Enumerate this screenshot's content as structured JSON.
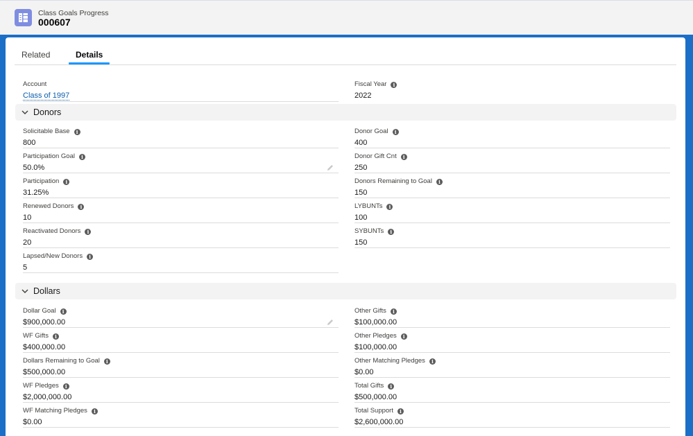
{
  "header": {
    "object_type": "Class Goals Progress",
    "record_name": "000607"
  },
  "tabs": [
    {
      "label": "Related"
    },
    {
      "label": "Details"
    }
  ],
  "top_fields": {
    "account": {
      "label": "Account",
      "value": "Class of 1997"
    },
    "fiscal_year": {
      "label": "Fiscal Year",
      "value": "2022"
    }
  },
  "donors": {
    "title": "Donors",
    "left": [
      {
        "label": "Solicitable Base",
        "value": "800"
      },
      {
        "label": "Participation Goal",
        "value": "50.0%"
      },
      {
        "label": "Participation",
        "value": "31.25%"
      },
      {
        "label": "Renewed Donors",
        "value": "10"
      },
      {
        "label": "Reactivated Donors",
        "value": "20"
      },
      {
        "label": "Lapsed/New Donors",
        "value": "5"
      }
    ],
    "right": [
      {
        "label": "Donor Goal",
        "value": "400"
      },
      {
        "label": "Donor Gift Cnt",
        "value": "250"
      },
      {
        "label": "Donors Remaining to Goal",
        "value": "150"
      },
      {
        "label": "LYBUNTs",
        "value": "100"
      },
      {
        "label": "SYBUNTs",
        "value": "150"
      }
    ]
  },
  "dollars": {
    "title": "Dollars",
    "left": [
      {
        "label": "Dollar Goal",
        "value": "$900,000.00"
      },
      {
        "label": "WF Gifts",
        "value": "$400,000.00"
      },
      {
        "label": "Dollars Remaining to Goal",
        "value": "$500,000.00"
      },
      {
        "label": "WF Pledges",
        "value": "$2,000,000.00"
      },
      {
        "label": "WF Matching Pledges",
        "value": "$0.00"
      }
    ],
    "right": [
      {
        "label": "Other Gifts",
        "value": "$100,000.00"
      },
      {
        "label": "Other Pledges",
        "value": "$100,000.00"
      },
      {
        "label": "Other Matching Pledges",
        "value": "$0.00"
      },
      {
        "label": "Total Gifts",
        "value": "$500,000.00"
      },
      {
        "label": "Total Support",
        "value": "$2,600,000.00"
      }
    ]
  },
  "info_glyph": "i",
  "icons": {
    "object": "table-grid-icon",
    "info": "info-icon",
    "edit": "pencil-icon",
    "section_toggle": "chevron-down-icon"
  },
  "colors": {
    "brand_blue": "#1b6fc7",
    "tab_active": "#1b96ff",
    "link": "#0b5cab",
    "object_icon": "#7f8de1"
  }
}
